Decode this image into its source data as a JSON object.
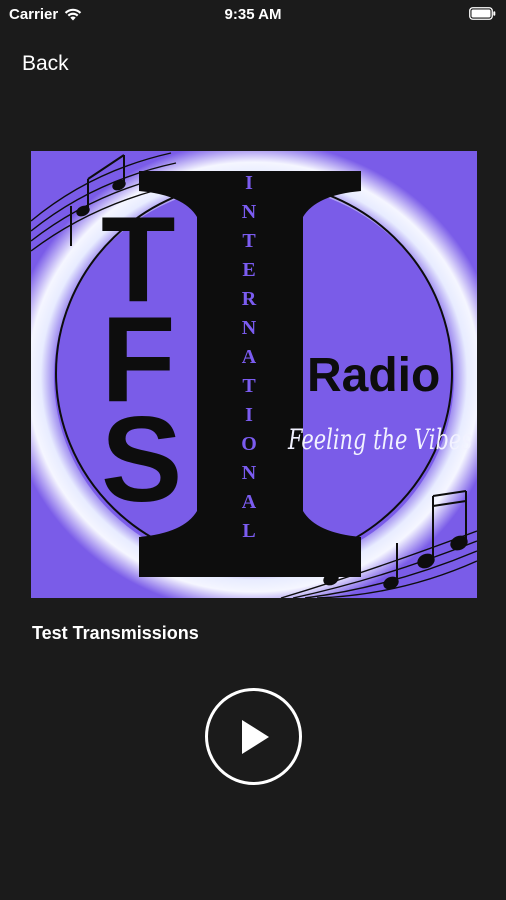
{
  "status_bar": {
    "carrier": "Carrier",
    "time": "9:35 AM",
    "wifi_icon": "wifi-icon",
    "battery_icon": "battery-icon"
  },
  "nav": {
    "back_label": "Back"
  },
  "artwork": {
    "logo_letters": "TFS",
    "logo_big_letter": "I",
    "logo_vertical_text": "INTERNATIONAL",
    "logo_word": "Radio",
    "logo_tagline": "Feeling the Vibes",
    "colors": {
      "background": "#7a5ce8",
      "glow": "#e8ecff",
      "ink": "#0d0d0d",
      "vertical_text": "#7b5cf0"
    }
  },
  "player": {
    "track_title": "Test Transmissions",
    "play_icon": "play-icon"
  },
  "colors": {
    "screen_background": "#1b1b1b",
    "text": "#ffffff"
  }
}
